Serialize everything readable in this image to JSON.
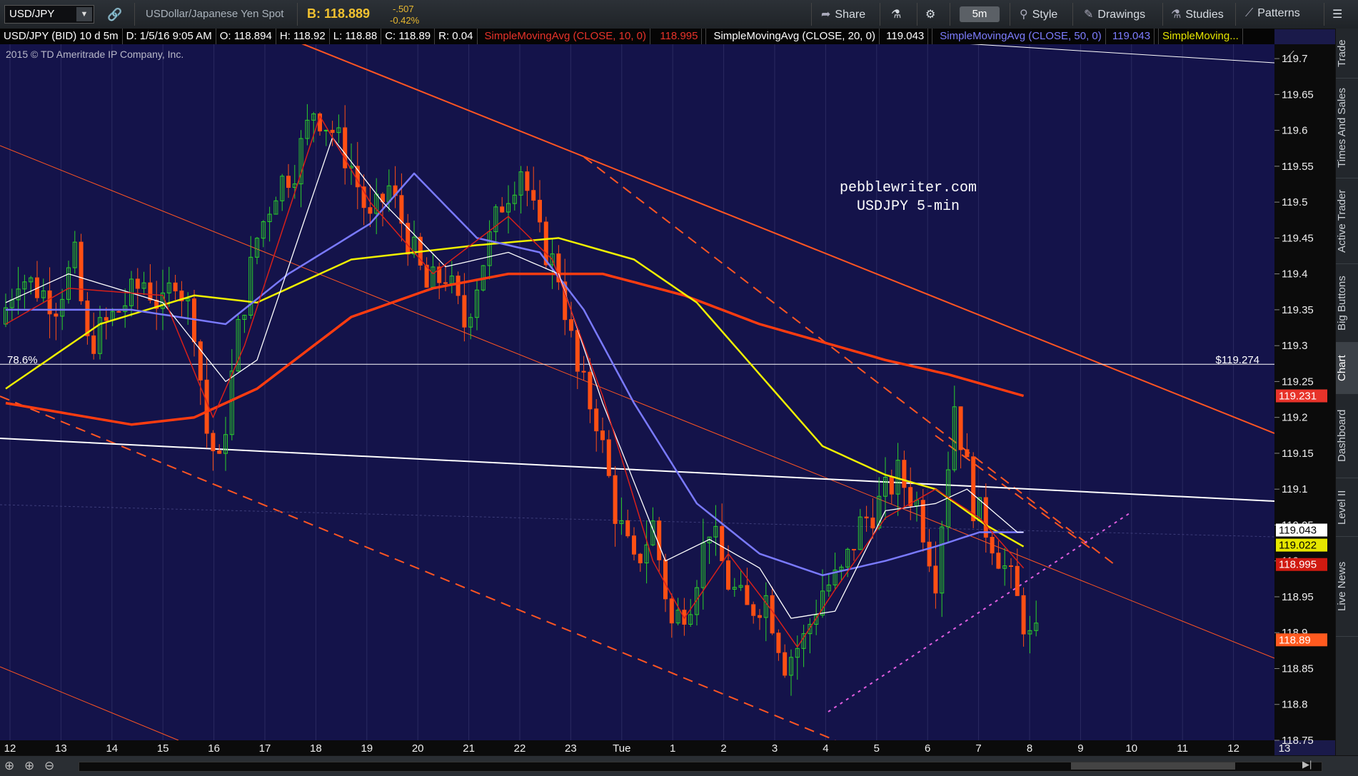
{
  "toolbar": {
    "symbol": "USD/JPY",
    "description": "USDollar/Japanese Yen Spot",
    "bid": "B: 118.889",
    "change": "-.507",
    "change_pct": "-0.42%",
    "share_label": "Share",
    "timeframe": "5m",
    "style_label": "Style",
    "drawings_label": "Drawings",
    "studies_label": "Studies",
    "patterns_label": "Patterns"
  },
  "infobar": {
    "symbol_period": "USD/JPY (BID) 10 d 5m",
    "date": "D: 1/5/16 9:05 AM",
    "open": "O: 118.894",
    "high": "H: 118.92",
    "low": "L: 118.88",
    "close": "C: 118.89",
    "range": "R: 0.04",
    "sma10_label": "SimpleMovingAvg (CLOSE, 10, 0)",
    "sma10_value": "118.995",
    "sma20_label": "SimpleMovingAvg (CLOSE, 20, 0)",
    "sma20_value": "119.043",
    "sma50_label": "SimpleMovingAvg (CLOSE, 50, 0)",
    "sma50_value": "119.043",
    "sma_more": "SimpleMoving..."
  },
  "chart": {
    "copyright": "2015 © TD Ameritrade IP Company, Inc.",
    "watermark_line1": "pebblewriter.com",
    "watermark_line2": "USDJPY 5-min",
    "fib_label": "78.6%",
    "fib_price_label": "$119.274",
    "price_ticks": [
      "119.7",
      "119.65",
      "119.6",
      "119.55",
      "119.5",
      "119.45",
      "119.4",
      "119.35",
      "119.3",
      "119.25",
      "119.2",
      "119.15",
      "119.1",
      "119.05",
      "119",
      "118.95",
      "118.9",
      "118.85",
      "118.8",
      "118.75"
    ],
    "time_ticks": [
      "12",
      "13",
      "14",
      "15",
      "16",
      "17",
      "18",
      "19",
      "20",
      "21",
      "22",
      "23",
      "Tue",
      "1",
      "2",
      "3",
      "4",
      "5",
      "6",
      "7",
      "8",
      "9",
      "10",
      "11",
      "12",
      "13"
    ],
    "price_badges": [
      {
        "text": "119.231",
        "color": "#e8332a",
        "price": 119.23
      },
      {
        "text": "119.043",
        "color": "#ffffff",
        "price": 119.043
      },
      {
        "text": "119.022",
        "color": "#e6e600",
        "price": 119.022
      },
      {
        "text": "118.995",
        "color": "#d01a10",
        "price": 118.995
      },
      {
        "text": "118.89",
        "color": "#ff5a1f",
        "price": 118.89
      }
    ]
  },
  "chart_data": {
    "type": "candlestick",
    "y_range": [
      118.75,
      119.72
    ],
    "series": [
      {
        "name": "SimpleMovingAvg (CLOSE, 10, 0)",
        "color": "#e8332a"
      },
      {
        "name": "SimpleMovingAvg (CLOSE, 20, 0)",
        "color": "#ffffff"
      },
      {
        "name": "SimpleMovingAvg (CLOSE, 50, 0)",
        "color": "#7d7dff"
      },
      {
        "name": "SimpleMoving...",
        "color": "#e6e600"
      }
    ],
    "anchors": [
      [
        0,
        119.33
      ],
      [
        3,
        119.4
      ],
      [
        6,
        119.38
      ],
      [
        9,
        119.36
      ],
      [
        12,
        119.42
      ],
      [
        14,
        119.3
      ],
      [
        17,
        119.33
      ],
      [
        20,
        119.36
      ],
      [
        23,
        119.39
      ],
      [
        26,
        119.35
      ],
      [
        28,
        119.4
      ],
      [
        31,
        119.33
      ],
      [
        33,
        119.18
      ],
      [
        35,
        119.13
      ],
      [
        38,
        119.32
      ],
      [
        41,
        119.45
      ],
      [
        44,
        119.52
      ],
      [
        47,
        119.55
      ],
      [
        50,
        119.63
      ],
      [
        53,
        119.6
      ],
      [
        56,
        119.55
      ],
      [
        59,
        119.47
      ],
      [
        62,
        119.52
      ],
      [
        65,
        119.45
      ],
      [
        68,
        119.38
      ],
      [
        71,
        119.4
      ],
      [
        74,
        119.33
      ],
      [
        77,
        119.42
      ],
      [
        80,
        119.5
      ],
      [
        83,
        119.55
      ],
      [
        86,
        119.45
      ],
      [
        89,
        119.4
      ],
      [
        92,
        119.26
      ],
      [
        95,
        119.2
      ],
      [
        98,
        119.07
      ],
      [
        101,
        118.99
      ],
      [
        104,
        119.05
      ],
      [
        107,
        118.91
      ],
      [
        110,
        118.95
      ],
      [
        113,
        119.05
      ],
      [
        116,
        118.97
      ],
      [
        119,
        118.93
      ],
      [
        122,
        118.95
      ],
      [
        125,
        118.86
      ],
      [
        128,
        118.89
      ],
      [
        131,
        118.96
      ],
      [
        134,
        118.98
      ],
      [
        137,
        119.05
      ],
      [
        140,
        119.08
      ],
      [
        143,
        119.12
      ],
      [
        146,
        119.08
      ],
      [
        149,
        118.98
      ],
      [
        152,
        119.22
      ],
      [
        155,
        119.08
      ],
      [
        158,
        119.03
      ],
      [
        161,
        118.97
      ],
      [
        164,
        118.89
      ]
    ],
    "sma_20_anchors": [
      [
        0,
        119.36
      ],
      [
        10,
        119.4
      ],
      [
        25,
        119.36
      ],
      [
        35,
        119.25
      ],
      [
        40,
        119.28
      ],
      [
        52,
        119.59
      ],
      [
        60,
        119.5
      ],
      [
        70,
        119.41
      ],
      [
        80,
        119.43
      ],
      [
        88,
        119.4
      ],
      [
        95,
        119.22
      ],
      [
        105,
        119.0
      ],
      [
        112,
        119.03
      ],
      [
        120,
        118.99
      ],
      [
        125,
        118.92
      ],
      [
        132,
        118.93
      ],
      [
        140,
        119.07
      ],
      [
        148,
        119.08
      ],
      [
        153,
        119.1
      ],
      [
        161,
        119.04
      ]
    ],
    "sma_50_anchors": [
      [
        0,
        119.35
      ],
      [
        20,
        119.35
      ],
      [
        35,
        119.33
      ],
      [
        45,
        119.4
      ],
      [
        58,
        119.47
      ],
      [
        65,
        119.54
      ],
      [
        75,
        119.45
      ],
      [
        85,
        119.43
      ],
      [
        92,
        119.35
      ],
      [
        100,
        119.22
      ],
      [
        110,
        119.08
      ],
      [
        120,
        119.01
      ],
      [
        130,
        118.98
      ],
      [
        140,
        119.0
      ],
      [
        148,
        119.02
      ],
      [
        155,
        119.04
      ],
      [
        161,
        119.04
      ]
    ],
    "sma_10_anchors": [
      [
        0,
        119.33
      ],
      [
        10,
        119.38
      ],
      [
        25,
        119.37
      ],
      [
        33,
        119.2
      ],
      [
        38,
        119.3
      ],
      [
        50,
        119.62
      ],
      [
        58,
        119.5
      ],
      [
        68,
        119.4
      ],
      [
        80,
        119.48
      ],
      [
        87,
        119.42
      ],
      [
        95,
        119.23
      ],
      [
        103,
        119.0
      ],
      [
        108,
        118.92
      ],
      [
        115,
        119.01
      ],
      [
        122,
        118.93
      ],
      [
        126,
        118.88
      ],
      [
        132,
        118.96
      ],
      [
        140,
        119.06
      ],
      [
        148,
        119.1
      ],
      [
        155,
        119.06
      ],
      [
        162,
        118.99
      ]
    ],
    "sma_yellow_anchors": [
      [
        0,
        119.24
      ],
      [
        15,
        119.33
      ],
      [
        30,
        119.37
      ],
      [
        40,
        119.36
      ],
      [
        55,
        119.42
      ],
      [
        75,
        119.44
      ],
      [
        88,
        119.45
      ],
      [
        100,
        119.42
      ],
      [
        110,
        119.36
      ],
      [
        120,
        119.26
      ],
      [
        130,
        119.16
      ],
      [
        140,
        119.12
      ],
      [
        148,
        119.1
      ],
      [
        156,
        119.05
      ],
      [
        162,
        119.02
      ]
    ],
    "sma_200_anchors": [
      [
        0,
        119.22
      ],
      [
        20,
        119.19
      ],
      [
        30,
        119.2
      ],
      [
        40,
        119.24
      ],
      [
        55,
        119.34
      ],
      [
        68,
        119.38
      ],
      [
        80,
        119.4
      ],
      [
        95,
        119.4
      ],
      [
        108,
        119.37
      ],
      [
        120,
        119.33
      ],
      [
        140,
        119.28
      ],
      [
        150,
        119.26
      ],
      [
        162,
        119.23
      ]
    ]
  }
}
